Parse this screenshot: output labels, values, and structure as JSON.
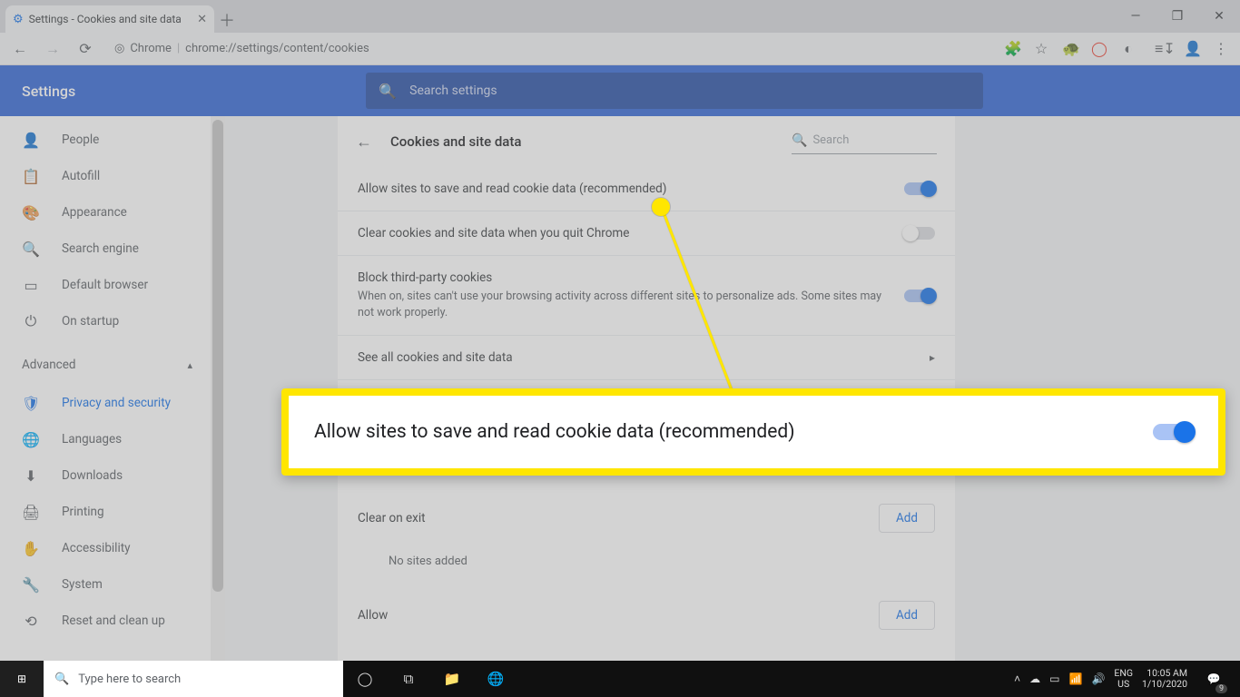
{
  "window": {
    "tab_title": "Settings - Cookies and site data",
    "url_label_app": "Chrome",
    "url": "chrome://settings/content/cookies"
  },
  "header": {
    "title": "Settings",
    "search_placeholder": "Search settings"
  },
  "sidebar": {
    "items": [
      {
        "icon": "👤",
        "label": "People"
      },
      {
        "icon": "📋",
        "label": "Autofill"
      },
      {
        "icon": "🎨",
        "label": "Appearance"
      },
      {
        "icon": "🔍",
        "label": "Search engine"
      },
      {
        "icon": "▭",
        "label": "Default browser"
      },
      {
        "icon": "⏻",
        "label": "On startup"
      }
    ],
    "advanced_label": "Advanced",
    "adv_items": [
      {
        "icon": "🛡",
        "label": "Privacy and security",
        "active": true
      },
      {
        "icon": "🌐",
        "label": "Languages"
      },
      {
        "icon": "⬇",
        "label": "Downloads"
      },
      {
        "icon": "🖨",
        "label": "Printing"
      },
      {
        "icon": "✋",
        "label": "Accessibility"
      },
      {
        "icon": "🔧",
        "label": "System"
      },
      {
        "icon": "⟲",
        "label": "Reset and clean up"
      }
    ]
  },
  "panel": {
    "title": "Cookies and site data",
    "search_placeholder": "Search",
    "rows": {
      "allow": {
        "label": "Allow sites to save and read cookie data (recommended)",
        "on": true
      },
      "clear": {
        "label": "Clear cookies and site data when you quit Chrome",
        "on": false
      },
      "block": {
        "label": "Block third-party cookies",
        "sub": "When on, sites can't use your browsing activity across different sites to personalize ads. Some sites may not work properly.",
        "on": true
      },
      "see_all": "See all cookies and site data"
    },
    "sections": {
      "clear_on_exit": {
        "title": "Clear on exit",
        "add": "Add",
        "empty": "No sites added"
      },
      "allow_sect": {
        "title": "Allow",
        "add": "Add"
      }
    }
  },
  "callout": {
    "label": "Allow sites to save and read cookie data (recommended)"
  },
  "taskbar": {
    "search_placeholder": "Type here to search",
    "lang1": "ENG",
    "lang2": "US",
    "time": "10:05 AM",
    "date": "1/10/2020",
    "notif_count": "9"
  }
}
